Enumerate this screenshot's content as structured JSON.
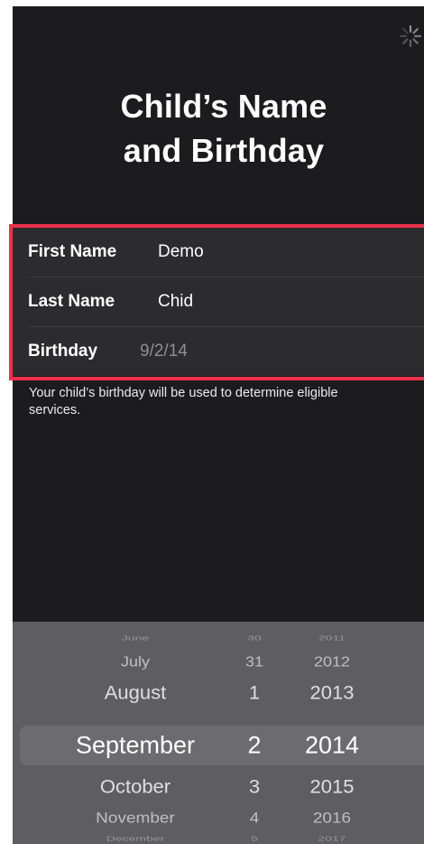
{
  "page": {
    "title_line1": "Child’s Name",
    "title_line2": "and Birthday"
  },
  "form": {
    "first_name": {
      "label": "First Name",
      "value": "Demo"
    },
    "last_name": {
      "label": "Last Name",
      "value": "Chid"
    },
    "birthday": {
      "label": "Birthday",
      "value": "9/2/14"
    }
  },
  "footnote": "Your child’s birthday will be used to determine eligible services.",
  "picker": {
    "months": [
      "June",
      "July",
      "August",
      "September",
      "October",
      "November",
      "December"
    ],
    "days": [
      "30",
      "31",
      "1",
      "2",
      "3",
      "4",
      "5"
    ],
    "years": [
      "2011",
      "2012",
      "2013",
      "2014",
      "2015",
      "2016",
      "2017"
    ],
    "selected": {
      "month": "September",
      "day": "2",
      "year": "2014"
    }
  },
  "icons": {
    "status": "activity-spinner-icon"
  },
  "colors": {
    "background": "#1c1c1e",
    "form_background": "#2c2c2e",
    "highlight_border": "#e8324b",
    "picker_background": "#5e5e62",
    "secondary_text": "#8e8e93"
  }
}
